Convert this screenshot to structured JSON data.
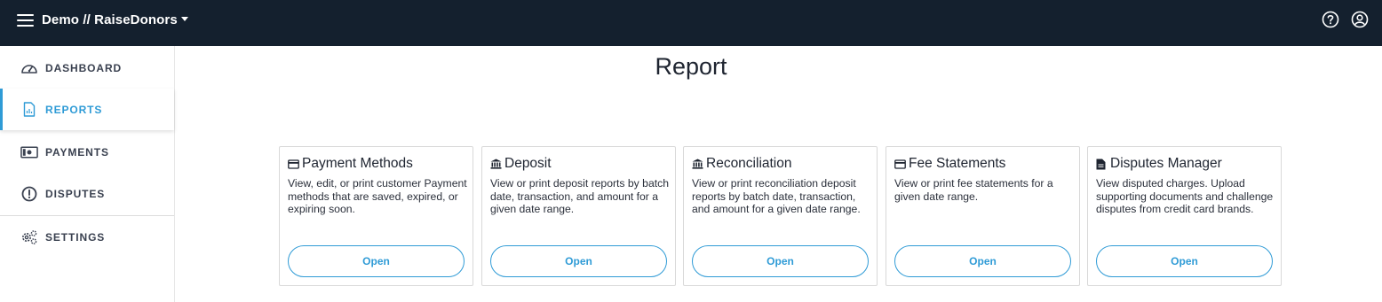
{
  "header": {
    "org_name": "Demo // RaiseDonors",
    "icons": [
      "menu-icon",
      "chevron-down-icon",
      "help-icon",
      "user-account-icon"
    ]
  },
  "sidebar": {
    "items": [
      {
        "label": "DASHBOARD",
        "icon": "gauge-icon"
      },
      {
        "label": "REPORTS",
        "icon": "report-document-icon",
        "active": true
      },
      {
        "label": "PAYMENTS",
        "icon": "money-icon"
      },
      {
        "label": "DISPUTES",
        "icon": "alert-circle-icon"
      },
      {
        "label": "SETTINGS",
        "icon": "gears-icon"
      }
    ]
  },
  "main": {
    "title": "Report",
    "cards": [
      {
        "title": "Payment Methods",
        "icon": "credit-card-icon",
        "description": "View, edit, or print customer Payment methods that are saved, expired, or expiring soon.",
        "button": "Open"
      },
      {
        "title": "Deposit",
        "icon": "bank-icon",
        "description": "View or print deposit reports by batch date, transaction, and amount for a given date range.",
        "button": "Open"
      },
      {
        "title": "Reconciliation",
        "icon": "bank-icon",
        "description": "View or print reconciliation deposit reports by batch date, transaction, and amount for a given date range.",
        "button": "Open"
      },
      {
        "title": "Fee Statements",
        "icon": "credit-card-icon",
        "description": "View or print fee statements for a given date range.",
        "button": "Open"
      },
      {
        "title": "Disputes Manager",
        "icon": "document-icon",
        "description": "View disputed charges. Upload supporting documents and challenge disputes from credit card brands.",
        "button": "Open"
      }
    ]
  },
  "colors": {
    "topbar": "#14202e",
    "accent": "#2f9bd6",
    "nav_text": "#3a4150"
  }
}
